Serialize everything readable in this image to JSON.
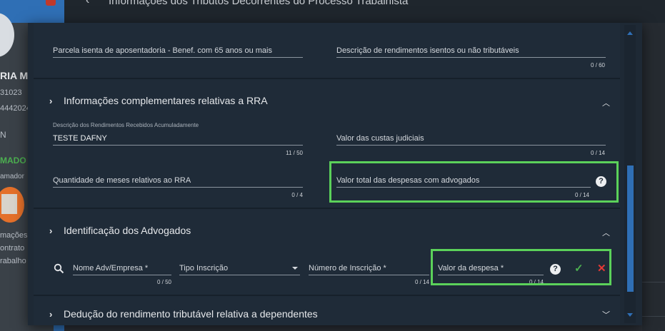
{
  "background": {
    "page_title": "Informações dos Tributos Decorrentes do Processo Trabalhista",
    "sidebar": {
      "name_fragment": "RIA M",
      "id_fragment": "31023",
      "phone_fragment": "4442024",
      "line_n": "N",
      "status": "MADO",
      "small_text": "amador",
      "menu_lines": [
        "mações",
        "ontrato",
        "rabalho"
      ]
    }
  },
  "dialog": {
    "top_section": {
      "field_left_label": "Parcela isenta de aposentadoria - Benef. com 65 anos ou mais",
      "field_right_label": "Descrição de rendimentos isentos ou não tributáveis",
      "field_right_counter": "0 / 60"
    },
    "rra_section": {
      "title": "Informações complementares relativas a RRA",
      "descricao_label": "Descrição dos Rendimentos Recebidos Acumuladamente",
      "descricao_value": "TESTE DAFNY",
      "descricao_counter": "11 / 50",
      "custas_label": "Valor das custas judiciais",
      "custas_counter": "0 / 14",
      "meses_label": "Quantidade de meses relativos ao RRA",
      "meses_counter": "0 / 4",
      "despesas_label": "Valor total das despesas com advogados",
      "despesas_counter": "0 / 14"
    },
    "advogados_section": {
      "title": "Identificação dos Advogados",
      "nome_label": "Nome Adv/Empresa *",
      "nome_counter": "0 / 50",
      "tipo_label": "Tipo Inscrição",
      "numero_label": "Número de Inscrição *",
      "numero_counter": "0 / 14",
      "valor_label": "Valor da despesa *",
      "valor_counter": "0 / 14"
    },
    "deducao_section": {
      "title": "Dedução do rendimento tributável relativa a dependentes"
    }
  },
  "icons": {
    "chevron_right": "›",
    "chevron_up": "︿",
    "chevron_down": "﹀",
    "help": "?",
    "check": "✓",
    "close": "✕",
    "back": "‹"
  },
  "colors": {
    "highlight": "#5bd15a",
    "accent": "#2f6fb5",
    "dialog_bg": "#1e2935",
    "check": "#4caf50",
    "cancel": "#e53935"
  }
}
